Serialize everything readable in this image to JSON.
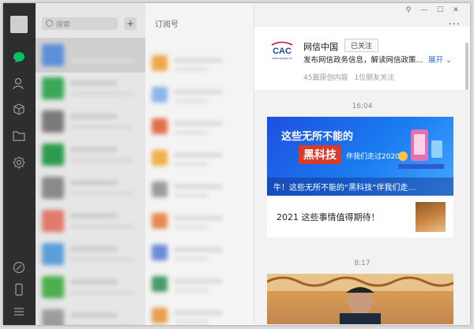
{
  "search": {
    "placeholder": "搜索",
    "add_label": "+"
  },
  "subscriptions": {
    "header": "订阅号"
  },
  "window_controls": {
    "pin": "⚲",
    "minimize": "—",
    "maximize": "☐",
    "close": "✕",
    "more": "···"
  },
  "account": {
    "name": "网信中国",
    "follow_status": "已关注",
    "description": "发布网信政务信息，解读网信政策...",
    "expand": "展开",
    "logo_text": "CAC",
    "logo_sub": "www.cac.gov.cn",
    "original_count": "45篇原创内容",
    "friends_following": "1位朋友关注"
  },
  "feed": [
    {
      "time": "16:04",
      "banner": {
        "line1": "这些无所不能的",
        "highlight": "黑科技",
        "line2": "伴我们走过2020"
      },
      "caption": "牛！这些无所不能的“黑科技”伴我们走...",
      "sub_item": "2021 这些事情值得期待！"
    },
    {
      "time": "8:17"
    }
  ],
  "colors": {
    "rail": "#2e2e2e",
    "accent_green": "#07c160",
    "link": "#2a6fc9",
    "banner_blue": "#1a7cf0",
    "highlight_red": "#d83a2c"
  }
}
